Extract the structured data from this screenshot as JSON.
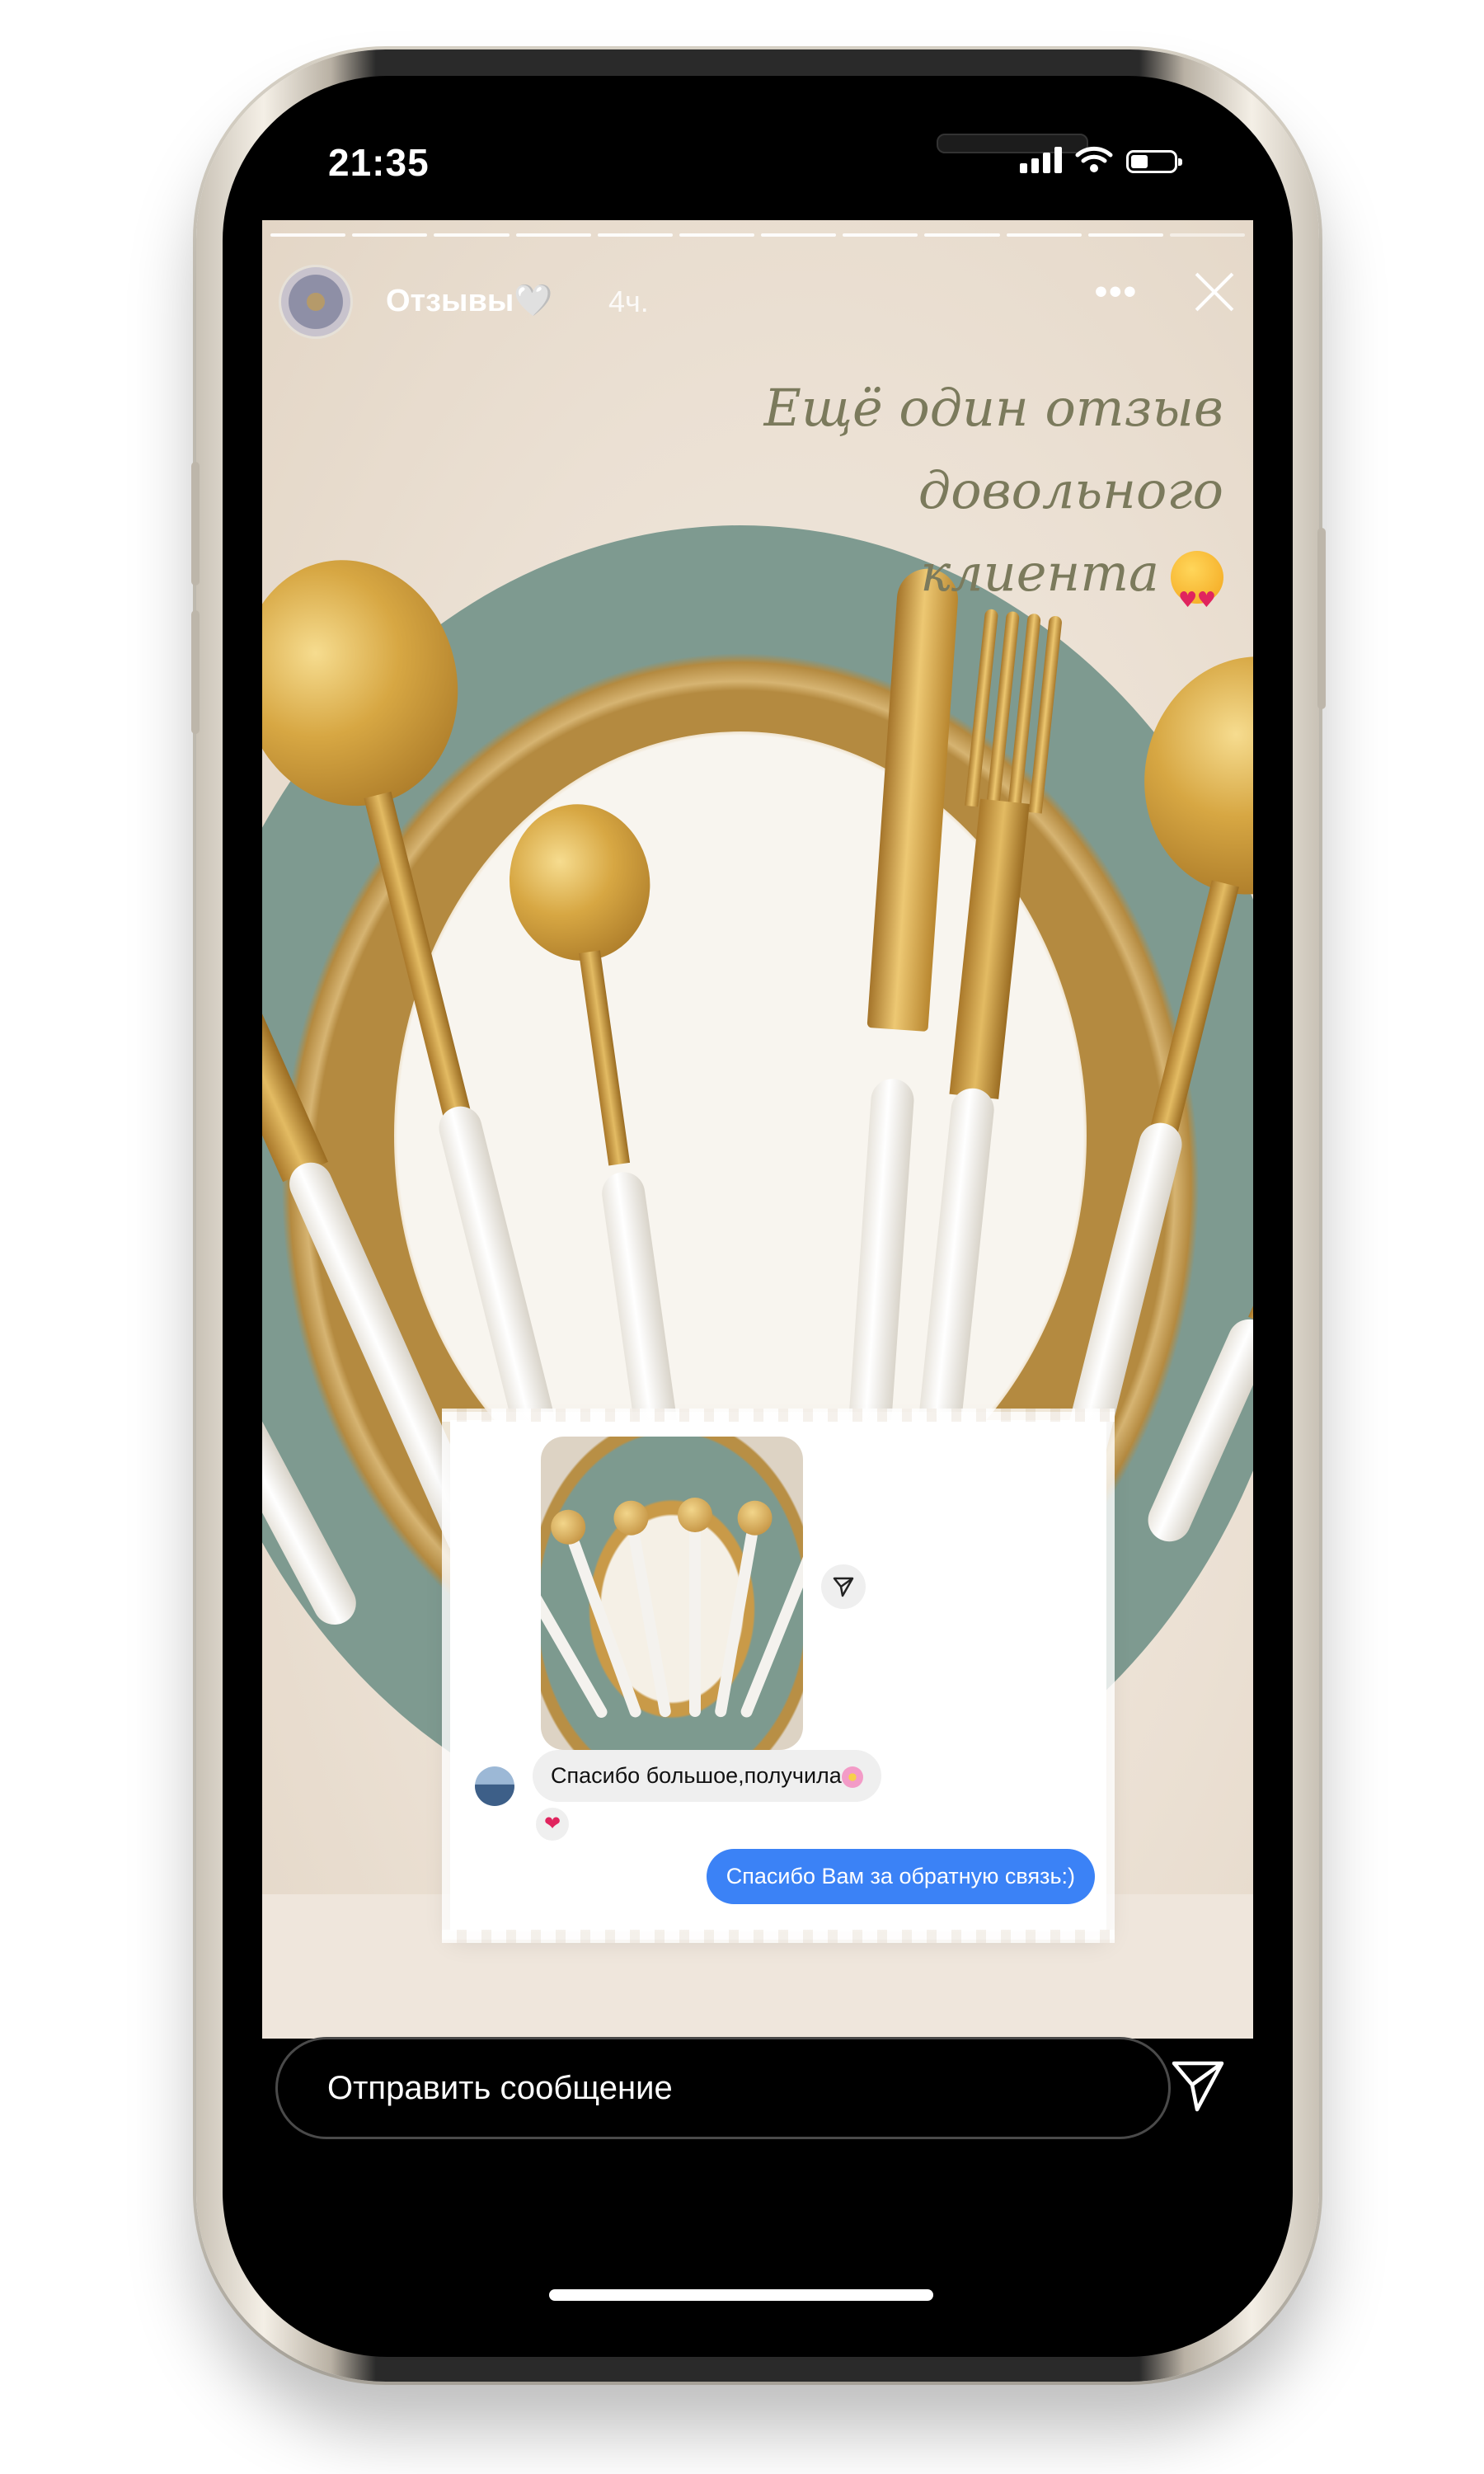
{
  "status_bar": {
    "time": "21:35",
    "icons": [
      "signal-icon",
      "wifi-icon",
      "battery-icon"
    ]
  },
  "story": {
    "progress_segments": 12,
    "account_name": "Отзывы🤍",
    "time_ago": "4ч.",
    "more_label": "•••",
    "caption_line1": "Ещё один отзыв довольного",
    "caption_line2": "клиента",
    "caption_emoji": "heart-eyes-emoji-icon"
  },
  "chat": {
    "incoming_message": "Спасибо большое,получила",
    "incoming_emoji": "flower-emoji-icon",
    "reaction": "heart-reaction-icon",
    "outgoing_message": "Спасибо Вам за обратную связь:)"
  },
  "reply": {
    "placeholder": "Отправить сообщение"
  },
  "colors": {
    "outgoing_bubble": "#3b82f6",
    "caption_text": "#7b7a5c",
    "gold": "#d7a743",
    "plate_green": "#7e9a90"
  }
}
